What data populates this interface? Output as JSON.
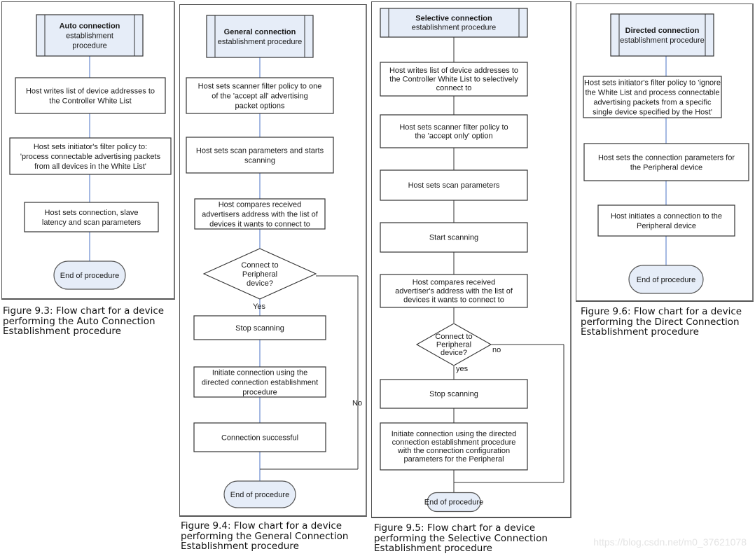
{
  "figures": [
    {
      "id": "auto",
      "start": {
        "title": "Auto connection",
        "subtitle": [
          "establishment",
          "procedure"
        ]
      },
      "steps": [
        [
          "Host writes list of device addresses to",
          "the Controller White List"
        ],
        [
          "Host sets initiator's filter policy to:",
          "'process connectable advertising packets",
          "from all devices in the White List'"
        ],
        [
          "Host sets connection, slave",
          "latency and scan parameters"
        ]
      ],
      "end": "End of procedure",
      "caption": "Figure 9.3: Flow chart for a device\nperforming the Auto Connection\nEstablishment procedure"
    },
    {
      "id": "general",
      "start": {
        "title": "General connection",
        "subtitle": [
          "establishment procedure"
        ]
      },
      "steps": [
        [
          "Host sets scanner filter policy to one",
          "of the 'accept all' advertising",
          "packet options"
        ],
        [
          "Host sets scan parameters and starts",
          "scanning"
        ],
        [
          "Host compares received",
          "advertisers address with the list of",
          "devices it wants to connect to"
        ]
      ],
      "decision": {
        "lines": [
          "Connect to",
          "Peripheral",
          "device?"
        ],
        "yes": "Yes",
        "no": "No"
      },
      "after": [
        [
          "Stop scanning"
        ],
        [
          "Initiate connection using the",
          "directed connection establishment",
          "procedure"
        ],
        [
          "Connection successful"
        ]
      ],
      "end": "End of procedure",
      "caption": "Figure 9.4: Flow chart for a device\nperforming the General Connection\nEstablishment procedure"
    },
    {
      "id": "selective",
      "start": {
        "title": "Selective connection",
        "subtitle": [
          "establishment procedure"
        ]
      },
      "steps": [
        [
          "Host writes list of device addresses to",
          "the Controller White List to selectively",
          "connect to"
        ],
        [
          "Host sets scanner filter policy to",
          "the 'accept only' option"
        ],
        [
          "Host sets scan parameters"
        ],
        [
          "Start scanning"
        ],
        [
          "Host compares received",
          "advertiser's address with the list of",
          "devices it wants to connect to"
        ]
      ],
      "decision": {
        "lines": [
          "Connect to",
          "Peripheral",
          "device?"
        ],
        "yes": "yes",
        "no": "no"
      },
      "after": [
        [
          "Stop scanning"
        ],
        [
          "Initiate connection using the directed",
          "connection establishment procedure",
          "with the connection configuration",
          "parameters for the Peripheral"
        ]
      ],
      "end": "End of procedure",
      "caption": "Figure 9.5: Flow chart for a device\nperforming the Selective Connection\nEstablishment procedure"
    },
    {
      "id": "directed",
      "start": {
        "title": "Directed connection",
        "subtitle": [
          "establishment procedure"
        ]
      },
      "steps": [
        [
          "Host sets initiator's filter policy to 'ignore",
          "the White List and process connectable",
          "advertising packets from a specific",
          "single device specified by the Host'"
        ],
        [
          "Host sets the connection parameters for",
          "the Peripheral device"
        ],
        [
          "Host initiates a connection to the",
          "Peripheral device"
        ]
      ],
      "end": "End of procedure",
      "caption": "Figure 9.6: Flow chart for a device\nperforming the Direct Connection\nEstablishment procedure"
    }
  ],
  "colors": {
    "start_fill": "#e6edf8",
    "connector_blue": "#4a72c4",
    "connector_dark": "#333333",
    "box_border": "#333333"
  },
  "watermark": "https://blog.csdn.net/m0_37621078"
}
